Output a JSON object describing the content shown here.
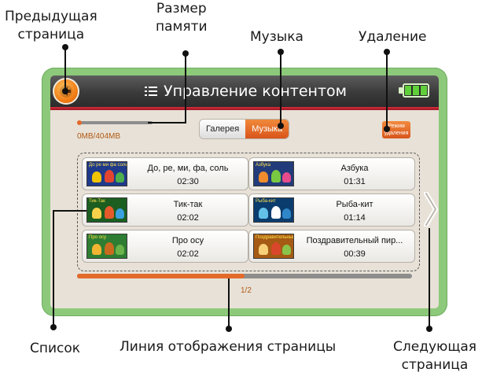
{
  "callouts": {
    "prev_page": [
      "Предыдущая",
      "страница"
    ],
    "memory_size": [
      "Размер",
      "памяти"
    ],
    "music": "Музыка",
    "delete": "Удаление",
    "list": "Список",
    "page_line": "Линия отображения страницы",
    "next_page": [
      "Следующая",
      "страница"
    ]
  },
  "titlebar": {
    "title": "Управление контентом",
    "back_icon": "back-arrow-icon",
    "menu_icon": "list-icon",
    "battery_icon": "battery-full-icon"
  },
  "memory": {
    "used_fraction": 0.0,
    "text": "0MB/404MB"
  },
  "tabs": [
    {
      "label": "Галерея",
      "selected": false
    },
    {
      "label": "Музыка",
      "selected": true
    }
  ],
  "delete_mode": [
    "Режим",
    "удаления"
  ],
  "items": [
    {
      "thumb_caption": "До ре ми фа соль",
      "name": "До, ре, ми, фа, соль",
      "duration": "02:30"
    },
    {
      "thumb_caption": "Азбука",
      "name": "Азбука",
      "duration": "01:31"
    },
    {
      "thumb_caption": "Тик-Так",
      "name": "Тик-так",
      "duration": "02:02"
    },
    {
      "thumb_caption": "Рыба-кит",
      "name": "Рыба-кит",
      "duration": "01:14"
    },
    {
      "thumb_caption": "Про осу",
      "name": "Про осу",
      "duration": "02:02"
    },
    {
      "thumb_caption": "Поздравительный пирог",
      "name": "Поздравительный пир...",
      "duration": "00:39"
    }
  ],
  "pagination": {
    "current": 1,
    "total": 2,
    "label": "1/2"
  },
  "colors": {
    "accent": "#e36a2b",
    "device_frame": "#8cc97a",
    "title_bar": "#3a3a3a",
    "title_stripe": "#c62432"
  }
}
